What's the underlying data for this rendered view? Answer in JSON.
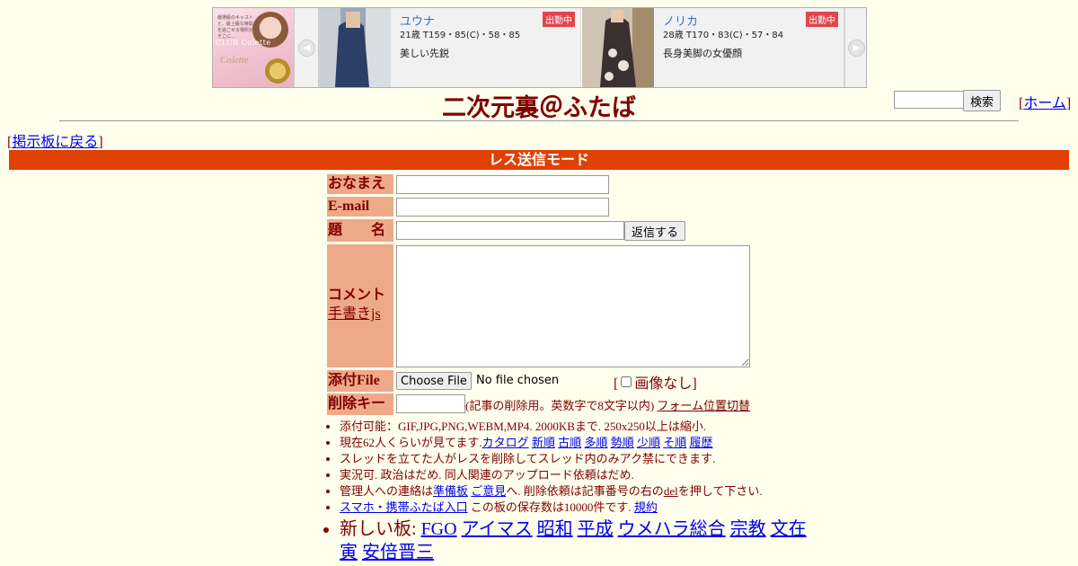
{
  "ad": {
    "logo_tagline": "厳選級のキャストと、最上級な時間を過ごせる場所がそこに…",
    "logo_brand": "CLUB Colette",
    "logo_script": "Colette",
    "cards": [
      {
        "name": "ユウナ",
        "badge": "出勤中",
        "stats": "21歳 T159・85(C)・58・85",
        "desc": "美しい先鋭"
      },
      {
        "name": "ノリカ",
        "badge": "出勤中",
        "stats": "28歳 T170・83(C)・57・84",
        "desc": "長身美脚の女優顔"
      }
    ]
  },
  "header": {
    "title": "二次元裏＠ふたば",
    "search_button": "検索",
    "home_open": "[",
    "home_link": "ホーム",
    "home_close": "]"
  },
  "nav": {
    "back_open": "[",
    "back_link": "掲示板に戻る",
    "back_close": "]"
  },
  "mode": {
    "label": "レス送信モード"
  },
  "form": {
    "name_label": "おなまえ",
    "email_label": "E-mail",
    "subject_label": "題　　名",
    "submit_label": "返信する",
    "comment_label": "コメント",
    "handwriting_link": "手書きjs",
    "file_label": "添付File",
    "choose_file": "Choose File",
    "no_file": "No file chosen",
    "no_image_open": "[",
    "no_image_label": "画像なし",
    "no_image_close": "]",
    "delkey_label": "削除キー",
    "delkey_note": "(記事の削除用。英数字で8文字以内)",
    "form_position_link": "フォーム位置切替"
  },
  "rules": {
    "r1": "添付可能：GIF,JPG,PNG,WEBM,MP4. 2000KBまで. 250x250以上は縮小.",
    "r2_prefix": "現在62人くらいが見てます.",
    "r2_links": [
      "カタログ",
      "新順",
      "古順",
      "多順",
      "勢順",
      "少順",
      "そ順",
      "履歴"
    ],
    "r3": "スレッドを立てた人がレスを削除してスレッド内のみアク禁にできます.",
    "r4": "実況可. 政治はだめ. 同人関連のアップロード依頼はだめ.",
    "r5_a": "管理人への連絡は",
    "r5_link1": "準備板",
    "r5_link2": "ご意見",
    "r5_b": "へ. 削除依頼は記事番号の右の",
    "r5_del": "del",
    "r5_c": "を押して下さい.",
    "r6_link": "スマホ・携帯ふたば入口",
    "r6_text": " この板の保存数は10000件です.",
    "r6_link2": "規約",
    "new_boards_label": "新しい板: ",
    "new_boards": [
      "FGO",
      "アイマス",
      "昭和",
      "平成",
      "ウメハラ総合",
      "宗教",
      "文在寅",
      "安倍晋三"
    ]
  },
  "colors": {
    "background": "#ffffee",
    "text": "#800000",
    "label_bg": "#eeaa88",
    "mode_bar": "#e04000",
    "link": "#0000ee",
    "badge": "#e0474c"
  }
}
